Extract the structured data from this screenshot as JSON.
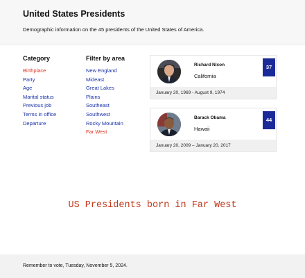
{
  "header": {
    "title": "United States Presidents",
    "description": "Demographic information on the 45 presidents of the United States of America."
  },
  "category": {
    "title": "Category",
    "items": [
      {
        "label": "Birthplace",
        "active": true
      },
      {
        "label": "Party",
        "active": false
      },
      {
        "label": "Age",
        "active": false
      },
      {
        "label": "Marital status",
        "active": false
      },
      {
        "label": "Previous job",
        "active": false
      },
      {
        "label": "Terms in office",
        "active": false
      },
      {
        "label": "Departure",
        "active": false
      }
    ]
  },
  "filter": {
    "title": "Filter by area",
    "items": [
      {
        "label": "New England",
        "active": false
      },
      {
        "label": "Mideast",
        "active": false
      },
      {
        "label": "Great Lakes",
        "active": false
      },
      {
        "label": "Plains",
        "active": false
      },
      {
        "label": "Southeast",
        "active": false
      },
      {
        "label": "Southwest",
        "active": false
      },
      {
        "label": "Rocky Mountain",
        "active": false
      },
      {
        "label": "Far West",
        "active": true
      }
    ]
  },
  "presidents": [
    {
      "name": "Richard Nixon",
      "state": "California",
      "number": "37",
      "term": "January 20, 1969 - August 9, 1974"
    },
    {
      "name": "Barack Obama",
      "state": "Hawaii",
      "number": "44",
      "term": "January 20, 2009 – January 20, 2017"
    }
  ],
  "banner": {
    "text": "US Presidents born in Far West"
  },
  "footer": {
    "note": "Remember to vote, Tuesday, November 5, 2024."
  },
  "colors": {
    "accent_blue": "#1b2a99",
    "link_blue": "#1a33a6",
    "active_red": "#e0301e",
    "banner_red": "#c0391b"
  }
}
